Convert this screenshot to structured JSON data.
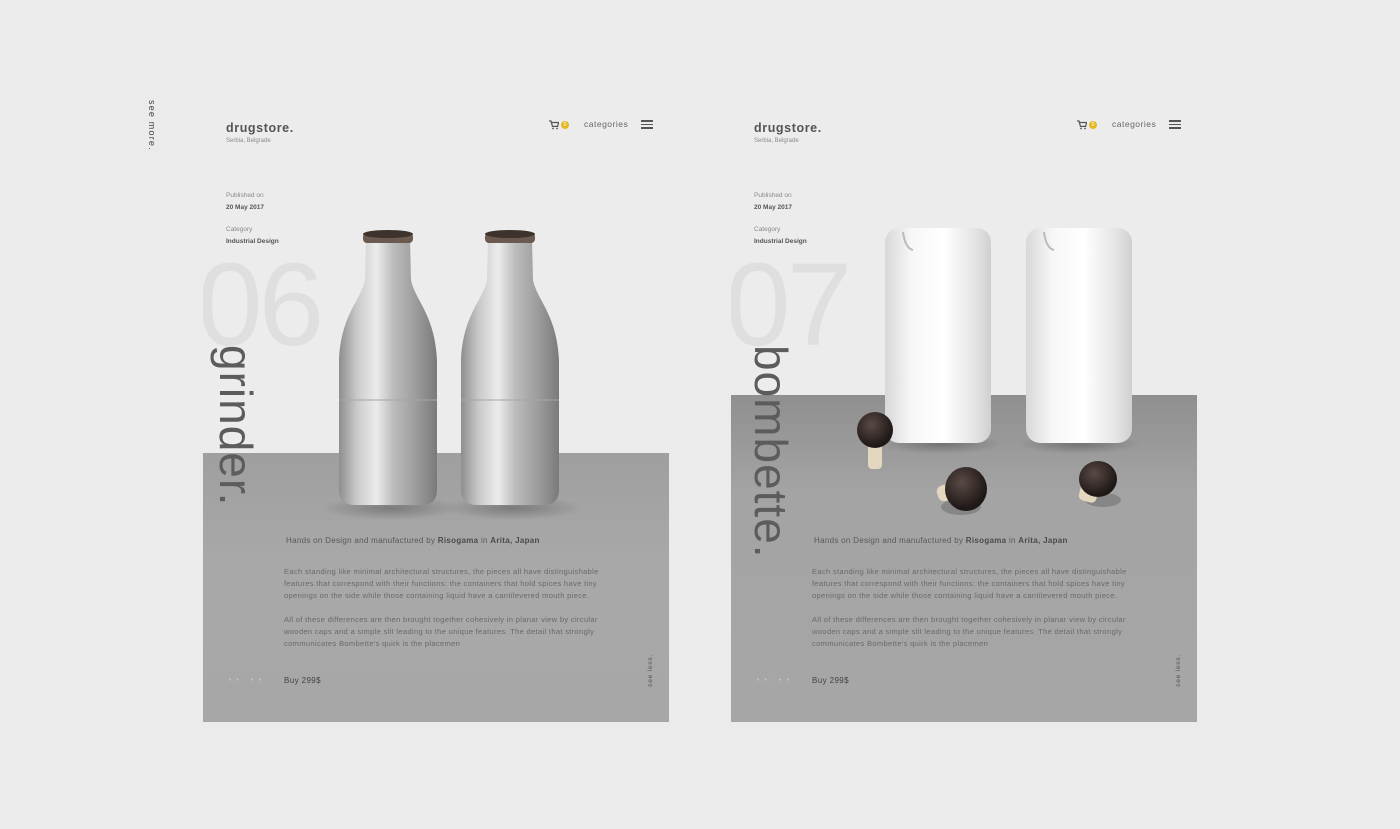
{
  "side": {
    "see_more": "see more."
  },
  "cards": [
    {
      "brand": "drugstore.",
      "location": "Serbia, Belgrade",
      "cart_count": "0",
      "categories_label": "categories",
      "published_label": "Published on",
      "published_date": "20 May 2017",
      "category_label": "Category",
      "category_value": "Industrial Design",
      "number": "06",
      "product_name": "grinder.",
      "designer_prefix": "Hands on Design and manufactured by ",
      "designer_maker": "Risogama",
      "designer_mid": " in ",
      "designer_place": "Arita, Japan",
      "paragraph_1": "Each standing like minimal architectural structures, the pieces all have distinguishable features that correspond with their functions: the containers that hold spices have tiny openings on the side while those containing liquid have a cantilevered mouth piece.",
      "paragraph_2": " All of these differences are then brought together cohesively in planar view by circular wooden caps and a simple slit leading to the unique features. The detail that strongly communicates Bombette's quirk is the placemen",
      "dots": "• • ·  • •",
      "buy_label": "Buy 299$",
      "see_less": "see less."
    },
    {
      "brand": "drugstore.",
      "location": "Serbia, Belgrade",
      "cart_count": "0",
      "categories_label": "categories",
      "published_label": "Published on",
      "published_date": "20 May 2017",
      "category_label": "Category",
      "category_value": "Industrial Design",
      "number": "07",
      "product_name": "bombette.",
      "designer_prefix": "Hands on Design and manufactured by ",
      "designer_maker": "Risogama",
      "designer_mid": " in ",
      "designer_place": "Arita, Japan",
      "paragraph_1": "Each standing like minimal architectural structures, the pieces all have distinguishable features that correspond with their functions: the containers that hold spices have tiny openings on the side while those containing liquid have a cantilevered mouth piece.",
      "paragraph_2": " All of these differences are then brought together cohesively in planar view by circular wooden caps and a simple slit leading to the unique features. The detail that strongly communicates Bombette's quirk is the placemen",
      "dots": "• • ·  • •",
      "buy_label": "Buy 299$",
      "see_less": "see less."
    }
  ],
  "colors": {
    "page_bg": "#ebebeb",
    "panel_gray": "#a5a5a5",
    "badge_yellow": "#e6b821",
    "text_dark": "#555555"
  },
  "icons": [
    "cart-icon",
    "menu-icon"
  ]
}
